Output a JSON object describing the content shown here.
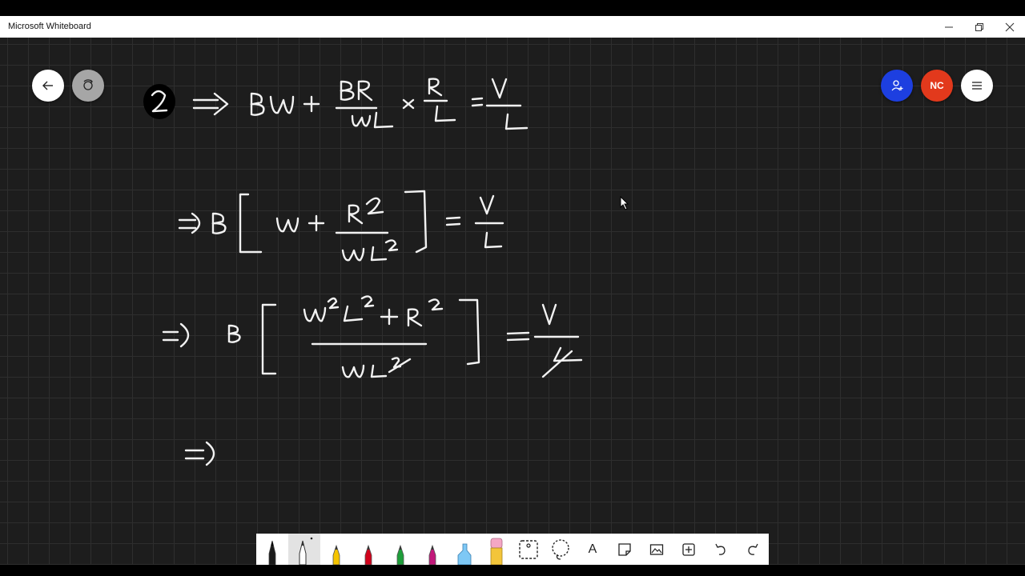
{
  "app": {
    "title": "Microsoft Whiteboard"
  },
  "window_controls": {
    "minimize": "minimize-icon",
    "restore": "restore-icon",
    "close": "close-icon"
  },
  "header": {
    "back": "back-arrow-icon",
    "share": "share-icon",
    "invite": "add-person-icon",
    "user_initials": "NC",
    "user_color": "#e2391c",
    "invite_color": "#1d3fe0",
    "menu": "hamburger-menu-icon"
  },
  "board": {
    "background": "#1d1d1d",
    "ink_color": "#f2f2f2",
    "content": "handwritten equations (ink strokes)"
  },
  "toolbar": {
    "tools": [
      {
        "name": "black-pen",
        "color": "#1a1a1a"
      },
      {
        "name": "white-pen",
        "color": "#ffffff",
        "selected": true
      },
      {
        "name": "yellow-pen",
        "color": "#f5c400"
      },
      {
        "name": "red-pen",
        "color": "#d0021b"
      },
      {
        "name": "green-pen",
        "color": "#1e9e3a"
      },
      {
        "name": "pink-pen",
        "color": "#c2187a"
      },
      {
        "name": "highlighter",
        "color": "#7ec8f5"
      },
      {
        "name": "eraser",
        "color": "#f4a7c5"
      },
      {
        "name": "ruler",
        "icon": "ruler-icon"
      },
      {
        "name": "lasso",
        "icon": "lasso-icon"
      },
      {
        "name": "text",
        "label": "A"
      },
      {
        "name": "sticky-note",
        "icon": "sticky-note-icon"
      },
      {
        "name": "image",
        "icon": "image-icon"
      },
      {
        "name": "insert",
        "icon": "plus-box-icon"
      },
      {
        "name": "undo",
        "icon": "undo-icon"
      },
      {
        "name": "redo",
        "icon": "redo-icon"
      }
    ]
  }
}
